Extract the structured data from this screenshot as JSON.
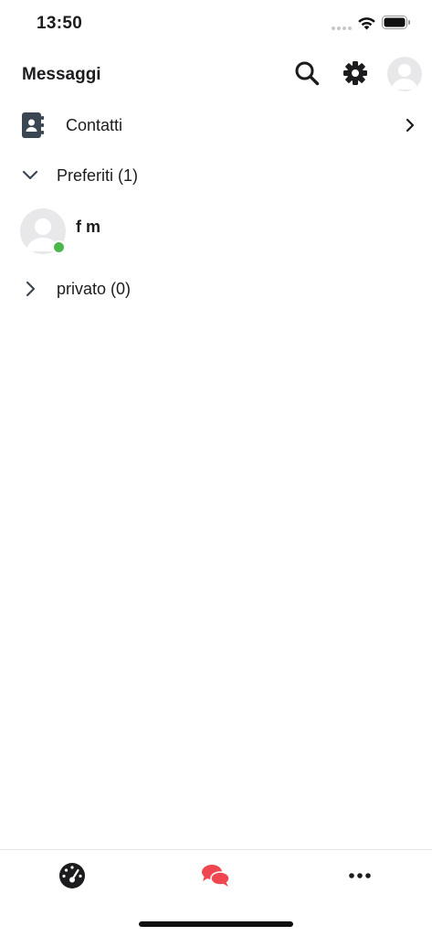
{
  "status_bar": {
    "time": "13:50"
  },
  "header": {
    "title": "Messaggi",
    "icons": {
      "search": "search-icon",
      "settings": "gear-icon",
      "profile": "avatar"
    }
  },
  "contacts_row": {
    "label": "Contatti",
    "icon": "address-book-icon",
    "chevron": "chevron-right-icon"
  },
  "groups": [
    {
      "label": "Preferiti (1)",
      "expanded": true,
      "contacts": [
        {
          "name": "f m",
          "status": "online"
        }
      ]
    },
    {
      "label": "privato (0)",
      "expanded": false,
      "contacts": []
    }
  ],
  "tab_bar": {
    "tabs": [
      {
        "icon": "dashboard-gauge-icon",
        "active": false
      },
      {
        "icon": "chat-bubbles-icon",
        "active": true
      },
      {
        "icon": "more-dots-icon",
        "active": false
      }
    ],
    "active_color": "#f0464f",
    "inactive_color": "#1c1c1e"
  },
  "colors": {
    "online": "#4cb84c",
    "text": "#1c1c1e",
    "accent": "#f0464f"
  }
}
